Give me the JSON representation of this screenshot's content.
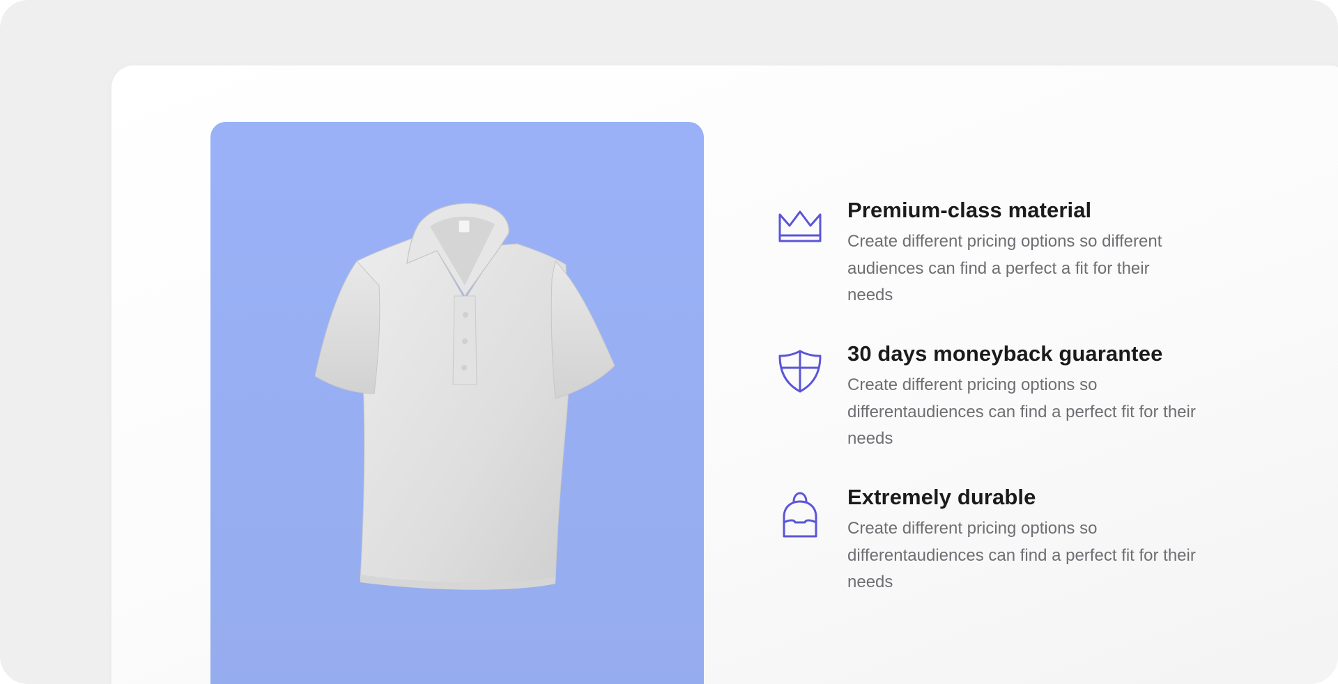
{
  "colors": {
    "accent": "#5b55d8",
    "panel": "#9ab1f8",
    "background": "#efefef",
    "card": "#ffffff"
  },
  "product": {
    "image_icon": "polo-shirt-image"
  },
  "features": [
    {
      "icon": "crown-icon",
      "title": "Premium-class material",
      "description": "Create different pricing options so different audiences can find a perfect a fit for their needs"
    },
    {
      "icon": "shield-icon",
      "title": "30 days moneyback guarantee",
      "description": "Create different pricing options so differentaudiences can find a perfect fit for their needs"
    },
    {
      "icon": "backpack-icon",
      "title": "Extremely durable",
      "description": "Create different pricing options so differentaudiences can find a perfect fit for their needs"
    }
  ]
}
